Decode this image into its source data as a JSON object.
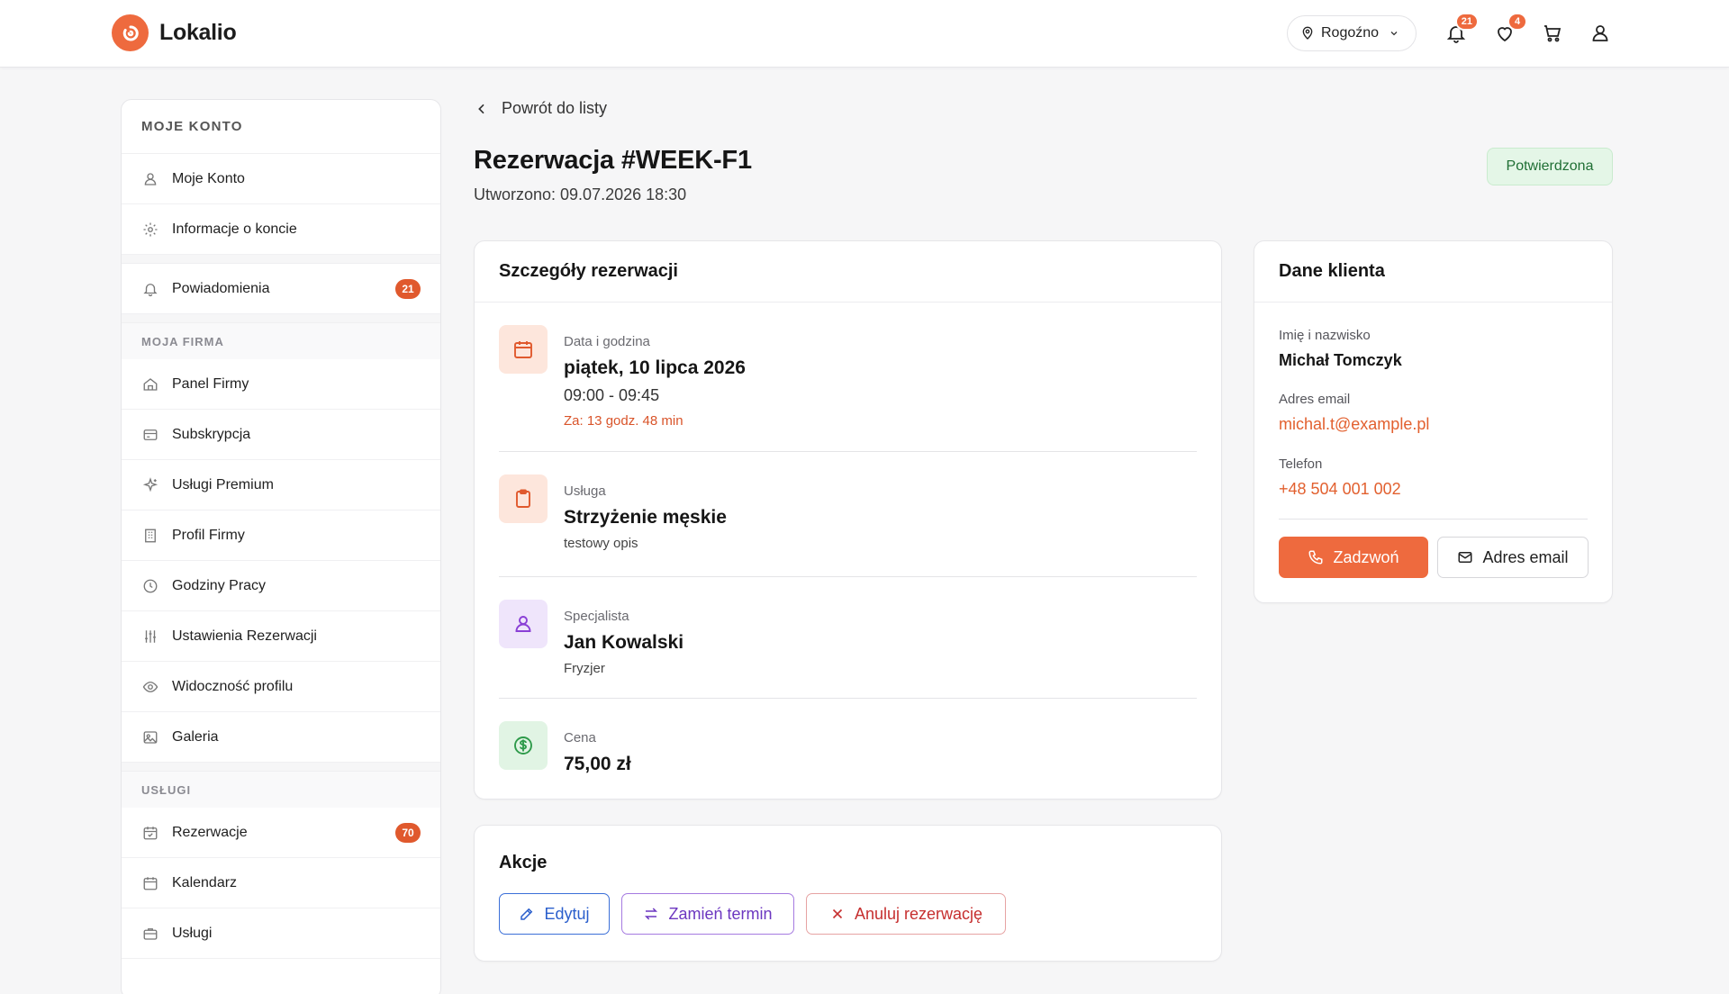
{
  "app": {
    "name": "Lokalio"
  },
  "header": {
    "location": "Rogoźno",
    "notifications_count": "21",
    "favorites_count": "4"
  },
  "sidebar": {
    "heading": "MOJE KONTO",
    "account_items": [
      {
        "label": "Moje Konto",
        "icon": "user-icon"
      },
      {
        "label": "Informacje o koncie",
        "icon": "gear-icon"
      }
    ],
    "notifications": {
      "label": "Powiadomienia",
      "badge": "21"
    },
    "company_section": "MOJA FIRMA",
    "company_items": [
      {
        "label": "Panel Firmy",
        "icon": "home-icon"
      },
      {
        "label": "Subskrypcja",
        "icon": "card-icon"
      },
      {
        "label": "Usługi Premium",
        "icon": "sparkles-icon"
      },
      {
        "label": "Profil Firmy",
        "icon": "building-icon"
      },
      {
        "label": "Godziny Pracy",
        "icon": "clock-icon"
      },
      {
        "label": "Ustawienia Rezerwacji",
        "icon": "sliders-icon"
      },
      {
        "label": "Widoczność profilu",
        "icon": "eye-icon"
      },
      {
        "label": "Galeria",
        "icon": "image-icon"
      }
    ],
    "services_section": "USŁUGI",
    "services_items": [
      {
        "label": "Rezerwacje",
        "icon": "calendar-check-icon",
        "badge": "70"
      },
      {
        "label": "Kalendarz",
        "icon": "calendar-icon"
      },
      {
        "label": "Usługi",
        "icon": "briefcase-icon"
      }
    ]
  },
  "main": {
    "back_label": "Powrót do listy",
    "title": "Rezerwacja #WEEK-F1",
    "created": "Utworzono: 09.07.2026 18:30",
    "status": "Potwierdzona",
    "details": {
      "heading": "Szczegóły rezerwacji",
      "date_label": "Data i godzina",
      "date_value": "piątek, 10 lipca 2026",
      "time_value": "09:00 - 09:45",
      "countdown": "Za: 13 godz. 48 min",
      "service_label": "Usługa",
      "service_value": "Strzyżenie męskie",
      "service_desc": "testowy opis",
      "specialist_label": "Specjalista",
      "specialist_value": "Jan Kowalski",
      "specialist_role": "Fryzjer",
      "price_label": "Cena",
      "price_value": "75,00 zł"
    },
    "client": {
      "heading": "Dane klienta",
      "name_label": "Imię i nazwisko",
      "name_value": "Michał Tomczyk",
      "email_label": "Adres email",
      "email_value": "michal.t@example.pl",
      "phone_label": "Telefon",
      "phone_value": "+48 504 001 002",
      "call_button": "Zadzwoń",
      "email_button": "Adres email"
    },
    "actions": {
      "heading": "Akcje",
      "edit": "Edytuj",
      "swap": "Zamień termin",
      "cancel": "Anuluj rezerwację"
    }
  },
  "colors": {
    "accent": "#ee6a3e",
    "status_bg": "#e4f6e7",
    "status_text": "#1f6f34"
  }
}
